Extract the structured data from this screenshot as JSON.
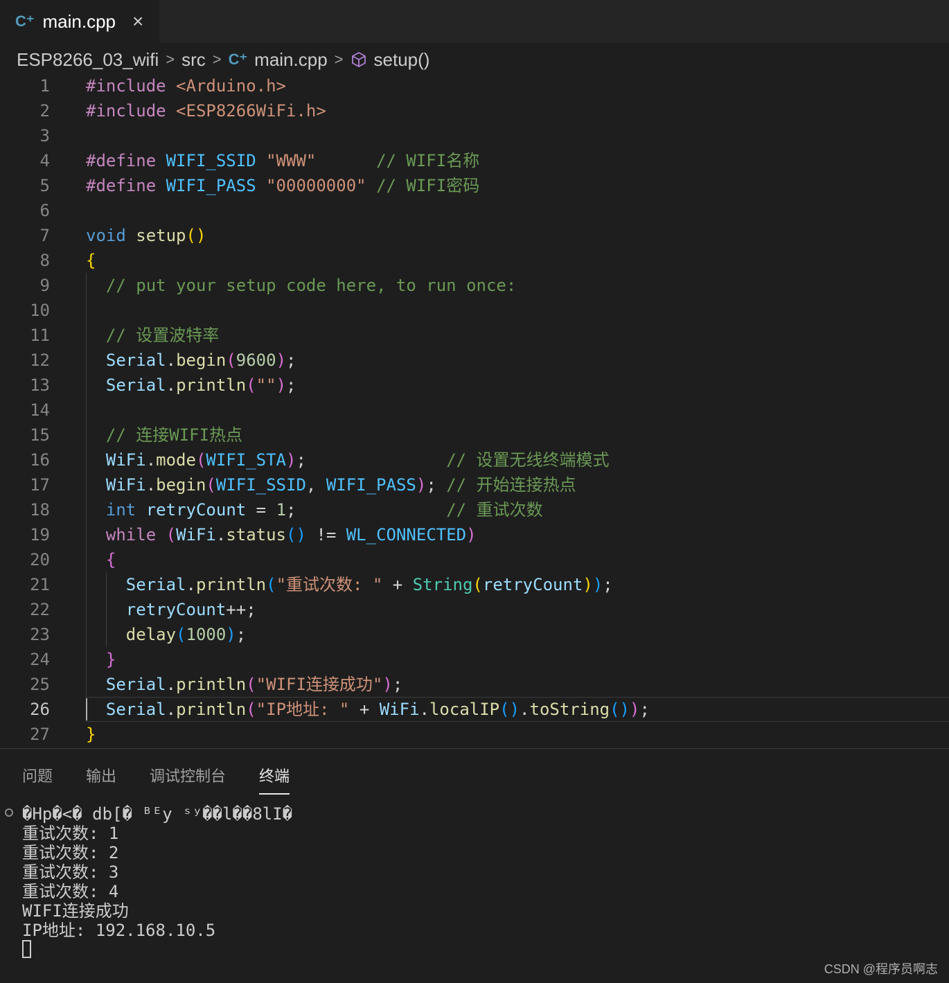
{
  "tab": {
    "title": "main.cpp",
    "close_glyph": "×",
    "icon": "cpp-file-icon"
  },
  "breadcrumb": {
    "items": [
      "ESP8266_03_wifi",
      "src",
      "main.cpp",
      "setup()"
    ],
    "separator": ">"
  },
  "editor": {
    "active_line": 26,
    "line_numbers": [
      "1",
      "2",
      "3",
      "4",
      "5",
      "6",
      "7",
      "8",
      "9",
      "10",
      "11",
      "12",
      "13",
      "14",
      "15",
      "16",
      "17",
      "18",
      "19",
      "20",
      "21",
      "22",
      "23",
      "24",
      "25",
      "26",
      "27"
    ],
    "lines": [
      "#include <Arduino.h>",
      "#include <ESP8266WiFi.h>",
      "",
      "#define WIFI_SSID \"WWW\"      // WIFI名称",
      "#define WIFI_PASS \"00000000\" // WIFI密码",
      "",
      "void setup()",
      "{",
      "  // put your setup code here, to run once:",
      "",
      "  // 设置波特率",
      "  Serial.begin(9600);",
      "  Serial.println(\"\");",
      "",
      "  // 连接WIFI热点",
      "  WiFi.mode(WIFI_STA);              // 设置无线终端模式",
      "  WiFi.begin(WIFI_SSID, WIFI_PASS); // 开始连接热点",
      "  int retryCount = 1;               // 重试次数",
      "  while (WiFi.status() != WL_CONNECTED)",
      "  {",
      "    Serial.println(\"重试次数: \" + String(retryCount));",
      "    retryCount++;",
      "    delay(1000);",
      "  }",
      "  Serial.println(\"WIFI连接成功\");",
      "  Serial.println(\"IP地址: \" + WiFi.localIP().toString());",
      "}"
    ]
  },
  "panel": {
    "tabs": [
      "问题",
      "输出",
      "调试控制台",
      "终端"
    ],
    "active_tab": "终端",
    "terminal_lines": [
      "�Hp�<� db[� ᴮᴱy ˢʸ��l��8lI�",
      "重试次数: 1",
      "重试次数: 2",
      "重试次数: 3",
      "重试次数: 4",
      "WIFI连接成功",
      "IP地址: 192.168.10.5"
    ]
  },
  "watermark": "CSDN @程序员啊志",
  "colors": {
    "editor_bg": "#1e1e1e",
    "tabbar_bg": "#252526",
    "keyword": "#569cd6",
    "preprocessor": "#c586c0",
    "string": "#ce9178",
    "comment": "#6a9955",
    "function": "#dcdcaa",
    "variable": "#9cdcfe",
    "macro": "#4fc1ff",
    "number": "#b5cea8",
    "type": "#4ec9b0",
    "bracket_1": "#ffd700",
    "bracket_2": "#da70d6",
    "bracket_3": "#179fff"
  }
}
